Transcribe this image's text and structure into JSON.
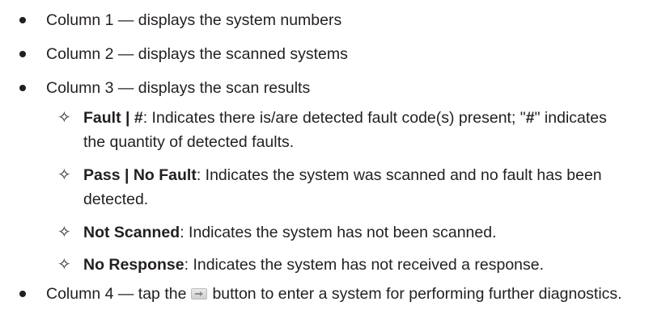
{
  "bullets": [
    {
      "text": "Column 1 — displays the system numbers"
    },
    {
      "text": "Column 2 — displays the scanned systems"
    },
    {
      "text": "Column 3 — displays the scan results"
    }
  ],
  "sub_items": [
    {
      "label": "Fault | #",
      "desc": ": Indicates there is/are detected fault code(s) present; \"",
      "desc_bold": "#",
      "desc_tail": "\" indicates the quantity of detected faults."
    },
    {
      "label": "Pass | No Fault",
      "desc": ": Indicates the system was scanned and no fault has been detected."
    },
    {
      "label": "Not Scanned",
      "desc": ": Indicates the system has not been scanned."
    },
    {
      "label": "No Response",
      "desc": ": Indicates the system has not received a response."
    }
  ],
  "last_bullet": {
    "before": "Column 4 — tap the",
    "icon": "arrow-button-icon",
    "after": "button to enter a system for performing further diagnostics."
  }
}
